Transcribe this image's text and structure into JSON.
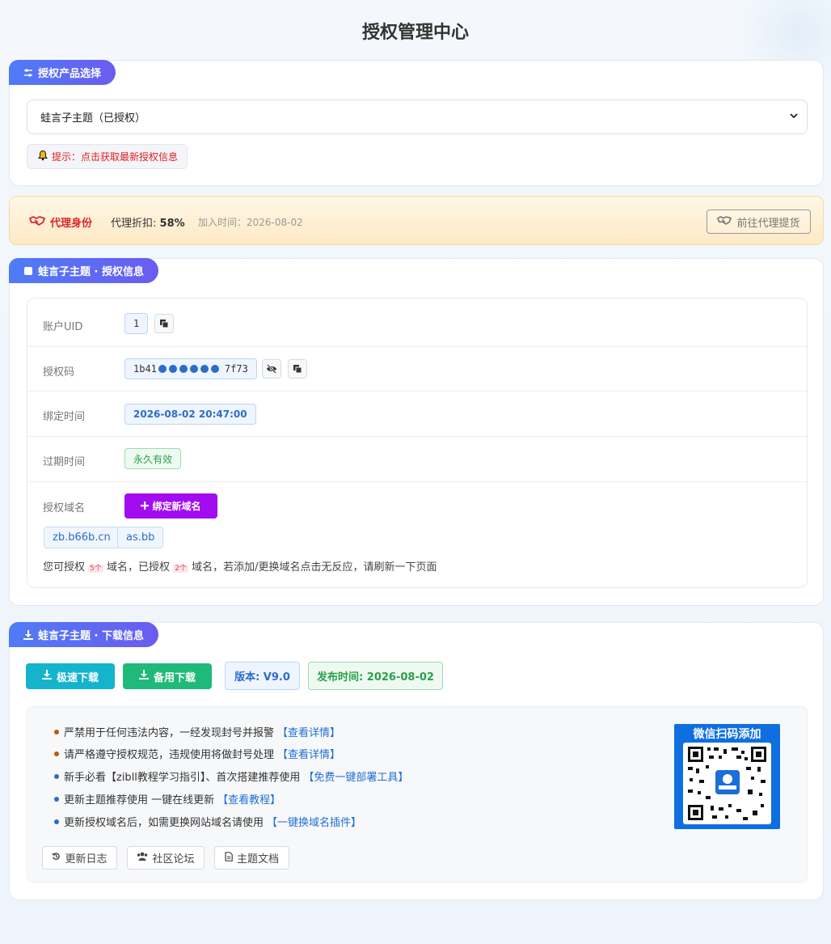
{
  "page": {
    "title": "授权管理中心"
  },
  "product": {
    "tab_label": "授权产品选择",
    "selected": "蛙言子主题（已授权）",
    "hint": "提示：点击获取最新授权信息"
  },
  "agent": {
    "title": "代理身份",
    "discount_label": "代理折扣:",
    "discount_value": "58%",
    "join_time": "加入时间：2026-08-02",
    "goto_button": "前往代理提货"
  },
  "license": {
    "tab_label": "蛙言子主题 · 授权信息",
    "uid_label": "账户UID",
    "uid_value": "1",
    "code_label": "授权码",
    "code_prefix": "1b41",
    "code_suffix": "7f73",
    "bind_time_label": "绑定时间",
    "bind_time_value": "2026-08-02 20:47:00",
    "expire_label": "过期时间",
    "expire_value": "永久有效",
    "domain_label": "授权域名",
    "bind_new_button": "绑定新域名",
    "domains": [
      "zb.b66b.cn",
      "as.bb"
    ],
    "note_1": "您可授权",
    "note_allowed": "5个",
    "note_2": "域名，已授权",
    "note_used": "2个",
    "note_3": "域名，若添加/更换域名点击无反应，请刷新一下页面"
  },
  "download": {
    "tab_label": "蛙言子主题 · 下载信息",
    "fast_button": "极速下载",
    "backup_button": "备用下载",
    "version": "版本: V9.0",
    "release": "发布时间: 2026-08-02",
    "notices": [
      {
        "text": "严禁用于任何违法内容，一经发现封号并报警",
        "link": "【查看详情】",
        "color": "#c2570c"
      },
      {
        "text": "请严格遵守授权规范，违规使用将做封号处理",
        "link": "【查看详情】",
        "color": "#c2570c"
      },
      {
        "text": "新手必看【zibll教程学习指引】、首次搭建推荐使用",
        "link": "【免费一键部署工具】",
        "color": "#2d6cc9"
      },
      {
        "text": "更新主题推荐使用 一键在线更新",
        "link": "【查看教程】",
        "color": "#2d6cc9"
      },
      {
        "text": "更新授权域名后，如需更换网站域名请使用",
        "link": "【一键换域名插件】",
        "color": "#2d6cc9"
      }
    ],
    "changelog": "更新日志",
    "forum": "社区论坛",
    "docs": "主题文档",
    "qr_title": "微信扫码添加"
  },
  "colors": {
    "accent": "#4f7cf6",
    "purple": "#a20cf0",
    "fast": "#14b4cc",
    "backup": "#1fba7a",
    "danger": "#e02020"
  }
}
